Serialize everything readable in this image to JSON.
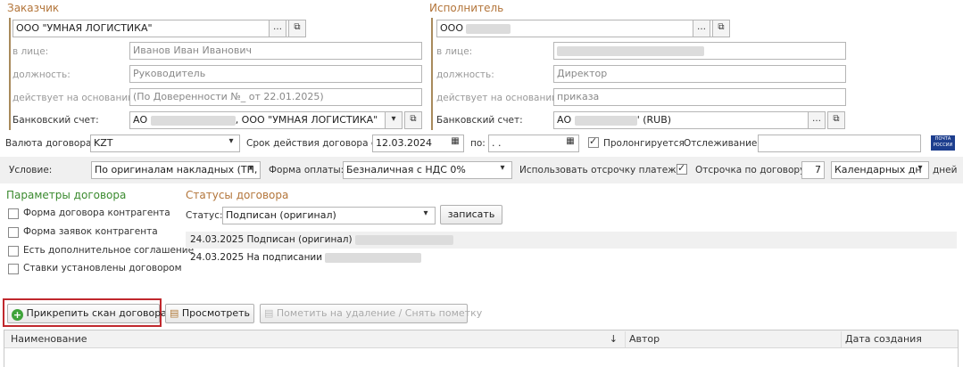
{
  "customer": {
    "title": "Заказчик",
    "name": "ООО \"УМНАЯ ЛОГИСТИКА\"",
    "rep_label": "в лице:",
    "rep_value": "Иванов Иван Иванович",
    "position_label": "должность:",
    "position_value": "Руководитель",
    "basis_label": "действует на основании:",
    "basis_value": "(По Доверенности №_ от 22.01.2025)",
    "bank_label": "Банковский счет:",
    "bank_value_prefix": "АО",
    "bank_value_suffix": ", ООО \"УМНАЯ ЛОГИСТИКА\""
  },
  "contractor": {
    "title": "Исполнитель",
    "name": "ООО",
    "rep_label": "в лице:",
    "position_label": "должность:",
    "position_value": "Директор",
    "basis_label": "действует на основании:",
    "basis_value": "приказа",
    "bank_label": "Банковский счет:",
    "bank_value_prefix": "АО",
    "bank_value_suffix": "' (RUB)"
  },
  "row1": {
    "currency_label": "Валюта договора:",
    "currency_value": "KZT",
    "term_label": "Срок действия договора с:",
    "term_from": "12.03.2024",
    "to_label": "по:",
    "to_value": ". .",
    "prolong_label": "Пролонгируется",
    "tracking_label": "Отслеживание:",
    "post_logo_line1": "ПОЧТА",
    "post_logo_line2": "РОССИИ"
  },
  "row2": {
    "condition_label": "Условие:",
    "condition_value": "По оригиналам накладных (ТН,",
    "payment_label": "Форма оплаты:",
    "payment_value": "Безналичная с НДС 0%",
    "deferral_label": "Использовать отсрочку платежа:",
    "deferral_contract_label": "Отсрочка по договору:",
    "deferral_days": "7",
    "deferral_type": "Календарных дн",
    "days_label": "дней"
  },
  "params": {
    "title": "Параметры договора",
    "items": [
      "Форма договора контрагента",
      "Форма заявок контрагента",
      "Есть дополнительное соглашение",
      "Ставки установлены договором"
    ]
  },
  "statuses": {
    "title": "Статусы договора",
    "status_label": "Статус:",
    "status_value": "Подписан (оригинал)",
    "save_button": "записать",
    "history": [
      "24.03.2025 Подписан (оригинал)",
      "24.03.2025 На подписании"
    ]
  },
  "toolbar": {
    "attach": "Прикрепить скан договора",
    "view": "Просмотреть",
    "mark_delete": "Пометить на удаление / Снять пометку"
  },
  "table": {
    "columns": [
      "Наименование",
      "Автор",
      "Дата создания"
    ],
    "sort_indicator": "↓"
  },
  "colors": {
    "section_title": "#b3753a",
    "green_title": "#3a8a2e",
    "highlight_border": "#c0282d"
  }
}
